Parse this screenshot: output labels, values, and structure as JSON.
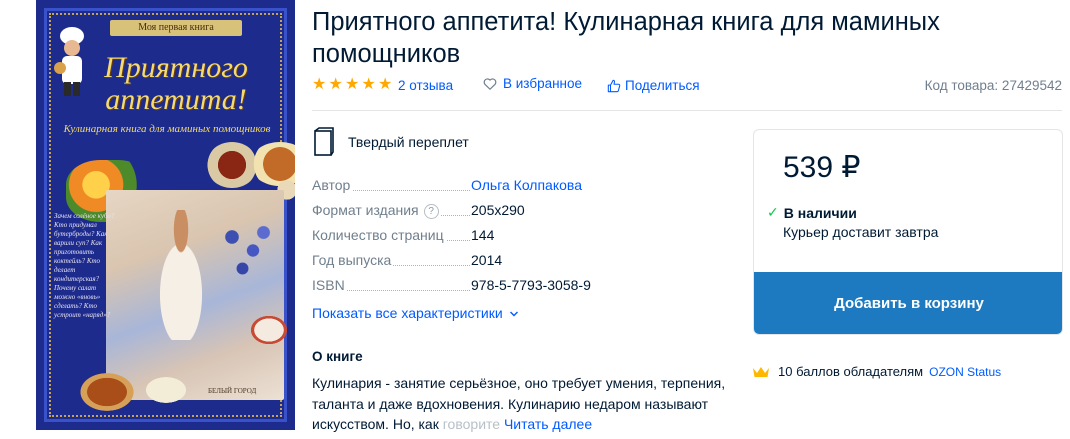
{
  "product": {
    "title": "Приятного аппетита! Кулинарная книга для маминых помощников",
    "rating_stars": 5,
    "reviews_label": "2 отзыва",
    "favorite_label": "В избранное",
    "share_label": "Поделиться",
    "sku_label": "Код товара: 27429542",
    "binding": "Твердый переплет"
  },
  "cover": {
    "series": "Моя первая книга",
    "title": "Приятного аппетита!",
    "subtitle": "Кулинарная книга для маминых помощников",
    "questions": "Зачем солёное кубо? Кто придумал бутерброды? Как варили суп? Как приготовить коктейль? Кто делает кондитерская? Почему салат можно «вновь» сделать? Кто устроит «наряд»?",
    "publisher": "БЕЛЫЙ ГОРОД"
  },
  "specs": [
    {
      "label": "Автор",
      "value": "Ольга Колпакова",
      "link": true,
      "help": false
    },
    {
      "label": "Формат издания",
      "value": "205x290",
      "link": false,
      "help": true
    },
    {
      "label": "Количество страниц",
      "value": "144",
      "link": false,
      "help": false
    },
    {
      "label": "Год выпуска",
      "value": "2014",
      "link": false,
      "help": false
    },
    {
      "label": "ISBN",
      "value": "978-5-7793-3058-9",
      "link": false,
      "help": false
    }
  ],
  "show_all_label": "Показать все характеристики",
  "about": {
    "title": "О книге",
    "text": "Кулинария - занятие серьёзное, оно требует умения, терпения, таланта и даже вдохновения. Кулинарию недаром называют искусством. Но, как ",
    "text_fade": "говорите",
    "read_more": "Читать далее"
  },
  "offer": {
    "price": "539 ₽",
    "stock": "В наличии",
    "delivery": "Курьер доставит завтра",
    "button": "Добавить в корзину"
  },
  "points": {
    "text": "10 баллов обладателям",
    "link": "OZON Status"
  },
  "colors": {
    "accent": "#005bff",
    "button": "#1d7ac0",
    "star": "#ffa800",
    "in_stock": "#10c44c",
    "muted": "#707f8d"
  }
}
